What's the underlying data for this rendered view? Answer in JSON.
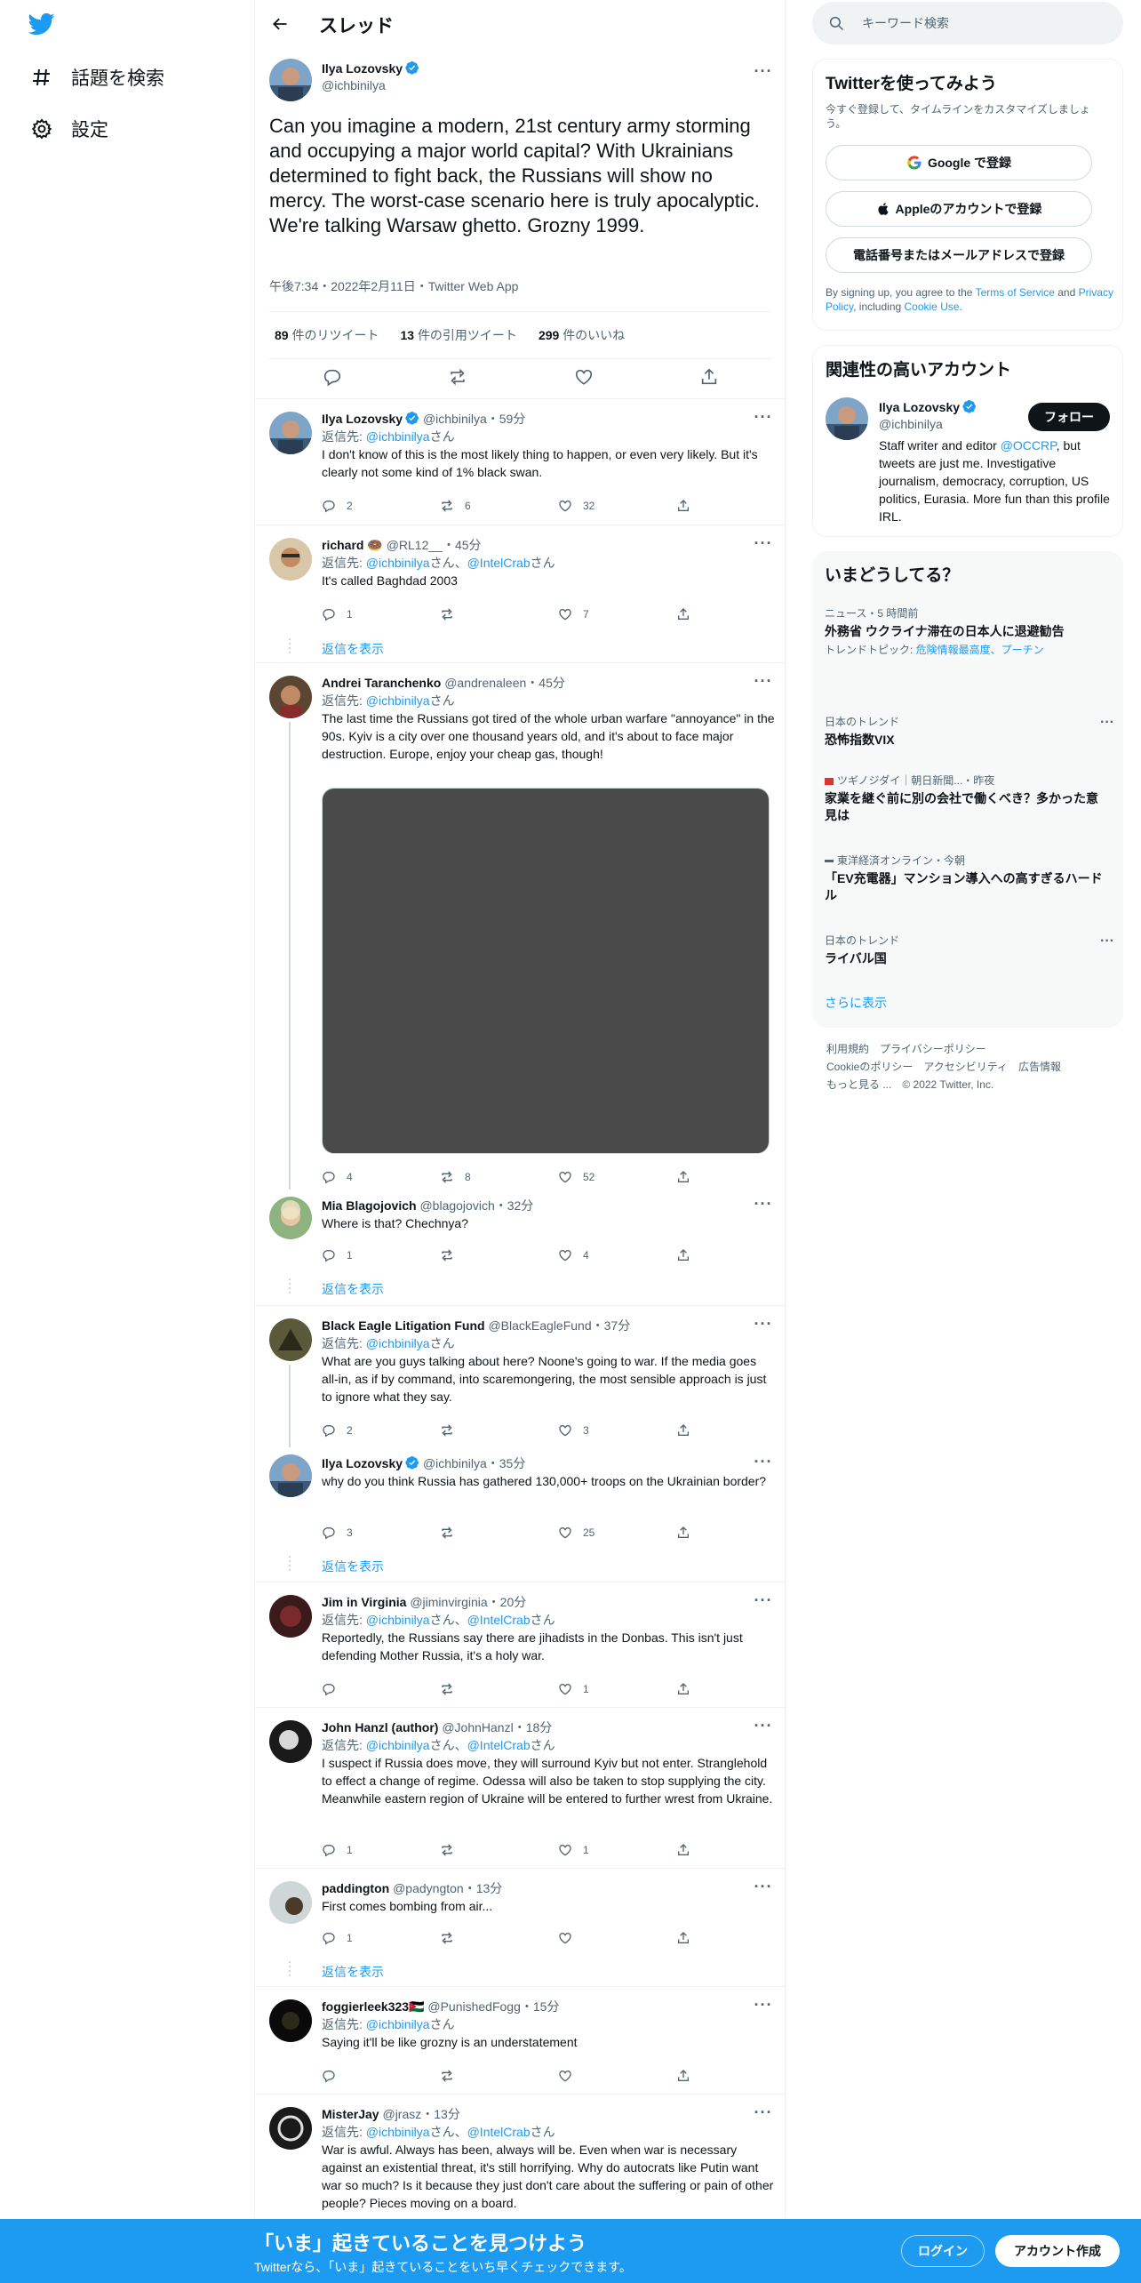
{
  "nav": {
    "explore_label": "話題を検索",
    "settings_label": "設定"
  },
  "header": {
    "title": "スレッド"
  },
  "main_tweet": {
    "name": "Ilya Lozovsky",
    "handle": "@ichbinilya",
    "text": "Can you imagine a modern, 21st century army storming and occupying a major world capital? With Ukrainians determined to fight back, the Russians will show no mercy. The worst-case scenario here is truly apocalyptic. We're talking Warsaw ghetto. Grozny 1999.",
    "meta": "午後7:34・2022年2月11日・Twitter Web App",
    "retweets_count": "89",
    "retweets_label": "件のリツイート",
    "quotes_count": "13",
    "quotes_label": "件の引用ツイート",
    "likes_count": "299",
    "likes_label": "件のいいね"
  },
  "replies": [
    {
      "name": "Ilya Lozovsky",
      "handle": "@ichbinilya",
      "time": "・59分",
      "reply_prefix": "返信先: ",
      "reply_user": "@ichbinilya",
      "reply_suffix": "さん",
      "text": "I don't know of this is the most likely thing to happen, or even very likely. But it's clearly not some kind of 1% black swan.",
      "replies": "2",
      "retweets": "6",
      "likes": "32"
    },
    {
      "name": "richard 🍩",
      "handle": "@RL12__",
      "time": "・45分",
      "reply_prefix": "返信先: ",
      "reply_user": "@ichbinilya",
      "reply_mid": "さん、",
      "reply_user2": "@IntelCrab",
      "reply_suffix": "さん",
      "text": "It's called Baghdad 2003",
      "replies": "1",
      "retweets": "",
      "likes": "7",
      "show_replies": "返信を表示"
    },
    {
      "name": "Andrei Taranchenko",
      "handle": "@andrenaleen",
      "time": "・45分",
      "reply_prefix": "返信先: ",
      "reply_user": "@ichbinilya",
      "reply_suffix": "さん",
      "text": "The last time the Russians got tired of the whole urban warfare \"annoyance\" in the 90s. Kyiv is a city over one thousand years old, and it's about to face major destruction. Europe, enjoy your cheap gas, though!",
      "replies": "4",
      "retweets": "8",
      "likes": "52"
    },
    {
      "name": "Mia Blagojovich",
      "handle": "@blagojovich",
      "time": "・32分",
      "text": "Where is that? Chechnya?",
      "replies": "1",
      "retweets": "",
      "likes": "4",
      "show_replies": "返信を表示"
    },
    {
      "name": "Black Eagle Litigation Fund",
      "handle": "@BlackEagleFund",
      "time": "・37分",
      "reply_prefix": "返信先: ",
      "reply_user": "@ichbinilya",
      "reply_suffix": "さん",
      "text": "What are you guys talking about here? Noone's going to war. If the media goes all-in, as if by command, into scaremongering, the most sensible approach is just to ignore what they say.",
      "replies": "2",
      "retweets": "",
      "likes": "3"
    },
    {
      "name": "Ilya Lozovsky",
      "handle": "@ichbinilya",
      "time": "・35分",
      "text": "why do you think Russia has gathered 130,000+ troops on the Ukrainian border?",
      "replies": "3",
      "retweets": "",
      "likes": "25",
      "show_replies": "返信を表示"
    },
    {
      "name": "Jim in Virginia",
      "handle": "@jiminvirginia",
      "time": "・20分",
      "reply_prefix": "返信先: ",
      "reply_user": "@ichbinilya",
      "reply_mid": "さん、",
      "reply_user2": "@IntelCrab",
      "reply_suffix": "さん",
      "text": "Reportedly, the Russians say there are jihadists in the Donbas. This isn't just defending Mother Russia, it's a holy war.",
      "replies": "",
      "retweets": "",
      "likes": "1"
    },
    {
      "name": "John Hanzl (author)",
      "handle": "@JohnHanzl",
      "time": "・18分",
      "reply_prefix": "返信先: ",
      "reply_user": "@ichbinilya",
      "reply_mid": "さん、",
      "reply_user2": "@IntelCrab",
      "reply_suffix": "さん",
      "text": "I suspect if Russia does move, they will surround Kyiv but not enter. Stranglehold to effect a change of regime. Odessa will also be taken to stop supplying the city. Meanwhile eastern region of Ukraine will be entered to further wrest from Ukraine.",
      "replies": "1",
      "retweets": "",
      "likes": "1"
    },
    {
      "name": "paddington",
      "handle": "@padyngton",
      "time": "・13分",
      "text": "First comes bombing from air...",
      "replies": "1",
      "retweets": "",
      "likes": "",
      "show_replies": "返信を表示"
    },
    {
      "name": "foggierleek323🇯🇴",
      "handle": "@PunishedFogg",
      "time": "・15分",
      "reply_prefix": "返信先: ",
      "reply_user": "@ichbinilya",
      "reply_suffix": "さん",
      "text": "Saying it'll be like grozny is an understatement",
      "replies": "",
      "retweets": "",
      "likes": ""
    },
    {
      "name": "MisterJay",
      "handle": "@jrasz",
      "time": "・13分",
      "reply_prefix": "返信先: ",
      "reply_user": "@ichbinilya",
      "reply_mid": "さん、",
      "reply_user2": "@IntelCrab",
      "reply_suffix": "さん",
      "text": "War is awful. Always has been, always will be. Even when war is necessary against an existential threat, it's still horrifying. Why do autocrats like Putin want war so much? Is it because they just don't care about the suffering or pain of other people? Pieces moving on a board."
    }
  ],
  "search": {
    "placeholder": "キーワード検索"
  },
  "signup_card": {
    "title": "Twitterを使ってみよう",
    "subtitle": "今すぐ登録して、タイムラインをカスタマイズしましょう。",
    "google": "Google で登録",
    "apple": "Appleのアカウントで登録",
    "phone": "電話番号またはメールアドレスで登録",
    "legal_1": "By signing up, you agree to the ",
    "legal_tos": "Terms of Service",
    "legal_2": " and ",
    "legal_pp": "Privacy Policy",
    "legal_3": ", including ",
    "legal_cookie": "Cookie Use",
    "legal_4": "."
  },
  "relevant_card": {
    "title": "関連性の高いアカウント",
    "name": "Ilya Lozovsky",
    "handle": "@ichbinilya",
    "follow": "フォロー",
    "bio_1": "Staff writer and editor ",
    "bio_link": "@OCCRP",
    "bio_2": ", but tweets are just me. Investigative journalism, democracy, corruption, US politics, Eurasia. More fun than this profile IRL."
  },
  "trends_card": {
    "title": "いまどうしてる？",
    "trends": [
      {
        "category": "ニュース・5 時間前",
        "title": "外務省 ウクライナ滞在の日本人に退避勧告",
        "sub_prefix": "トレンドトピック: ",
        "sub_link": "危険情報最高度、プーチン"
      },
      {
        "category": "日本のトレンド",
        "title": "恐怖指数VIX"
      },
      {
        "category": "ツギノジダイ｜朝日新聞...・昨夜",
        "title": "家業を継ぐ前に別の会社で働くべき？多かった意見は"
      },
      {
        "category": "東洋経済オンライン・今朝",
        "title": "「EV充電器」マンション導入への高すぎるハードル"
      },
      {
        "category": "日本のトレンド",
        "title": "ライバル国"
      }
    ],
    "show_more": "さらに表示"
  },
  "footer": {
    "terms": "利用規約",
    "privacy": "プライバシーポリシー",
    "cookie": "Cookieのポリシー",
    "accessibility": "アクセシビリティ",
    "ads": "広告情報",
    "more": "もっと見る ...",
    "copyright": "© 2022 Twitter, Inc."
  },
  "bottom_bar": {
    "title": "「いま」起きていることを見つけよう",
    "subtitle": "Twitterなら、「いま」起きていることをいち早くチェックできます。",
    "login": "ログイン",
    "signup": "アカウント作成"
  },
  "colors": {
    "accent": "#1d9bf0",
    "text": "#0f1419",
    "secondary": "#536471"
  }
}
